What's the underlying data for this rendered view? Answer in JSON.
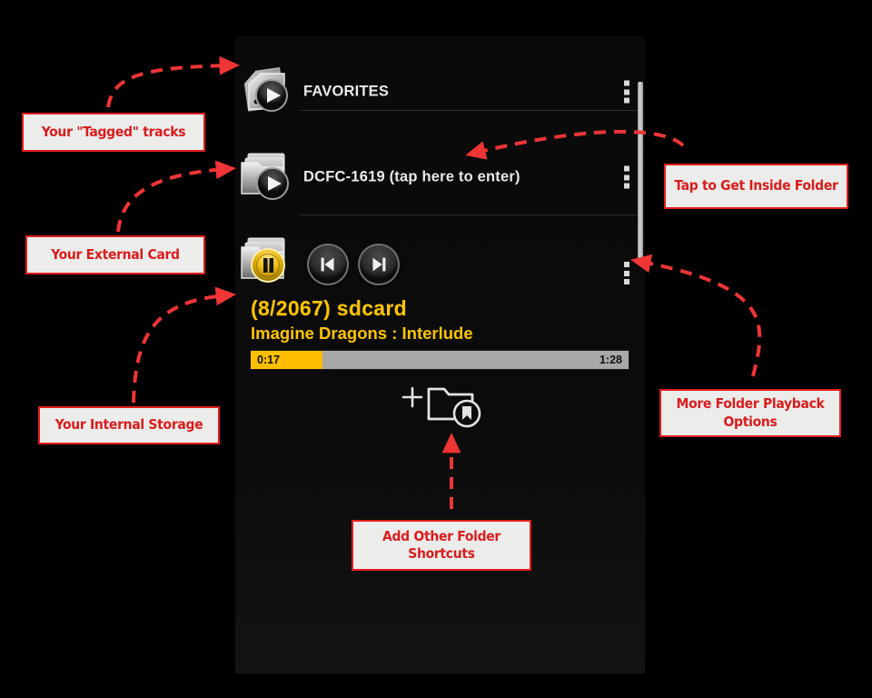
{
  "app": {
    "rows": [
      {
        "id": "favorites",
        "label": "FAVORITES",
        "icon": "tag-play-icon",
        "menu_icon": "overflow-menu-icon"
      },
      {
        "id": "dcfc-1619",
        "label": "DCFC-1619 (tap here to enter)",
        "icon": "folder-play-icon",
        "menu_icon": "overflow-menu-icon"
      },
      {
        "id": "sdcard",
        "label": "",
        "icon": "folder-pause-icon",
        "menu_icon": "overflow-menu-icon"
      }
    ],
    "transport": {
      "pause_label": "pause-button",
      "previous_label": "previous-track-button",
      "next_label": "next-track-button"
    },
    "now_playing": {
      "title": "(8/2067)  sdcard",
      "subtitle": "Imagine Dragons : Interlude",
      "elapsed": "0:17",
      "total": "1:28",
      "progress_percent": 19,
      "accent_color": "#ffc400",
      "progress_track_color": "#a8a8a8"
    },
    "add_shortcut": {
      "icon": "add-folder-bookmark-icon",
      "plus_glyph": "+"
    },
    "scrollbar": {
      "name": "vertical-scrollbar"
    }
  },
  "annotations": [
    {
      "id": "tagged-tracks",
      "text": "Your \"Tagged\" tracks"
    },
    {
      "id": "external-card",
      "text": "Your External Card"
    },
    {
      "id": "internal-storage",
      "text": "Your Internal Storage"
    },
    {
      "id": "inside-folder",
      "text": "Tap to Get Inside Folder"
    },
    {
      "id": "playback-options",
      "text": "More Folder Playback Options"
    },
    {
      "id": "add-shortcuts",
      "text": "Add Other Folder Shortcuts"
    }
  ],
  "theme": {
    "annotation_red": "#d81d1d",
    "annotation_bg": "#ececeb",
    "panel_bg": "#0b0b0b",
    "text_light": "#e9e9e9"
  }
}
